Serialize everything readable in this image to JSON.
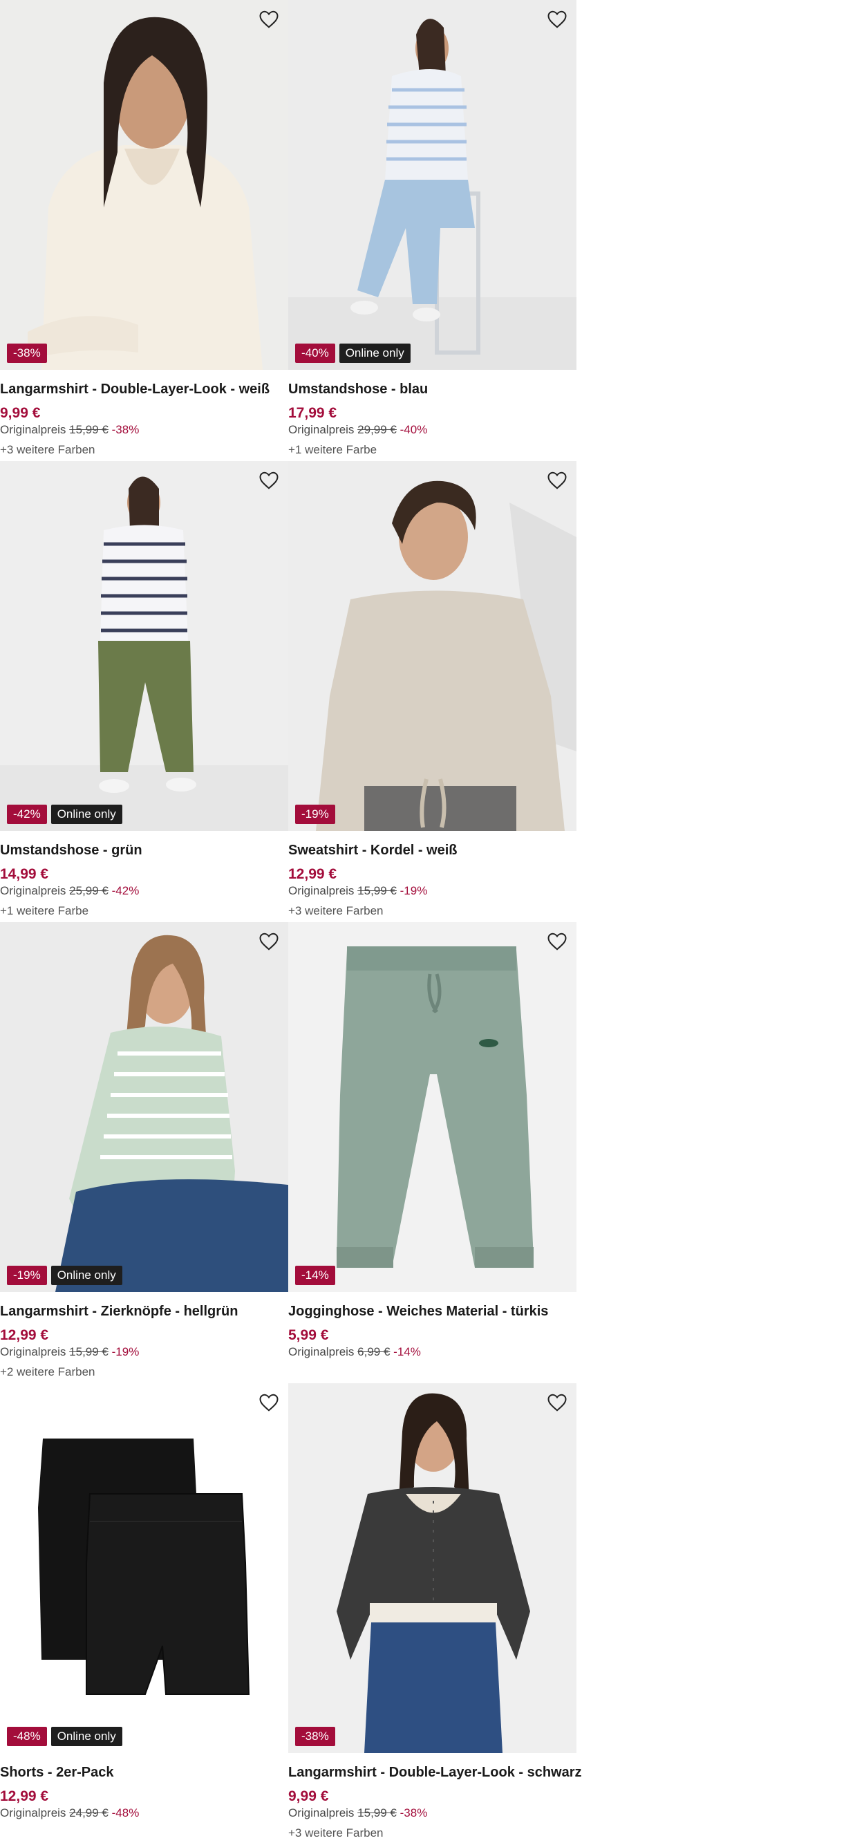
{
  "products": [
    {
      "name": "Langarmshirt - Double-Layer-Look - weiß",
      "price": "9,99 €",
      "orig_label": "Originalpreis",
      "orig_price": "15,99 €",
      "discount": "-38%",
      "badge": "-38%",
      "online_only": "",
      "more_colors": "+3 weitere Farben",
      "image": "woman-cream-top"
    },
    {
      "name": "Umstandshose - blau",
      "price": "17,99 €",
      "orig_label": "Originalpreis",
      "orig_price": "29,99 €",
      "discount": "-40%",
      "badge": "-40%",
      "online_only": "Online only",
      "more_colors": "+1 weitere Farbe",
      "image": "pregnant-blue-jeans"
    },
    {
      "name": "Umstandshose - grün",
      "price": "14,99 €",
      "orig_label": "Originalpreis",
      "orig_price": "25,99 €",
      "discount": "-42%",
      "badge": "-42%",
      "online_only": "Online only",
      "more_colors": "+1 weitere Farbe",
      "image": "pregnant-green-pants"
    },
    {
      "name": "Sweatshirt - Kordel - weiß",
      "price": "12,99 €",
      "orig_label": "Originalpreis",
      "orig_price": "15,99 €",
      "discount": "-19%",
      "badge": "-19%",
      "online_only": "",
      "more_colors": "+3 weitere Farben",
      "image": "woman-beige-sweatshirt"
    },
    {
      "name": "Langarmshirt - Zierknöpfe - hellgrün",
      "price": "12,99 €",
      "orig_label": "Originalpreis",
      "orig_price": "15,99 €",
      "discount": "-19%",
      "badge": "-19%",
      "online_only": "Online only",
      "more_colors": "+2 weitere Farben",
      "image": "woman-striped-green-top"
    },
    {
      "name": "Jogginghose - Weiches Material - türkis",
      "price": "5,99 €",
      "orig_label": "Originalpreis",
      "orig_price": "6,99 €",
      "discount": "-14%",
      "badge": "-14%",
      "online_only": "",
      "more_colors": "",
      "image": "sage-jogging-pants"
    },
    {
      "name": "Shorts - 2er-Pack",
      "price": "12,99 €",
      "orig_label": "Originalpreis",
      "orig_price": "24,99 €",
      "discount": "-48%",
      "badge": "-48%",
      "online_only": "Online only",
      "more_colors": "",
      "image": "black-shorts-pack"
    },
    {
      "name": "Langarmshirt - Double-Layer-Look - schwarz",
      "price": "9,99 €",
      "orig_label": "Originalpreis",
      "orig_price": "15,99 €",
      "discount": "-38%",
      "badge": "-38%",
      "online_only": "",
      "more_colors": "+3 weitere Farben",
      "image": "woman-black-top"
    }
  ],
  "icons": {
    "wishlist": "heart-outline-icon"
  },
  "colors": {
    "accent": "#a30d3b",
    "online_badge": "#1e1e1e",
    "image_bg": "#ececec"
  }
}
